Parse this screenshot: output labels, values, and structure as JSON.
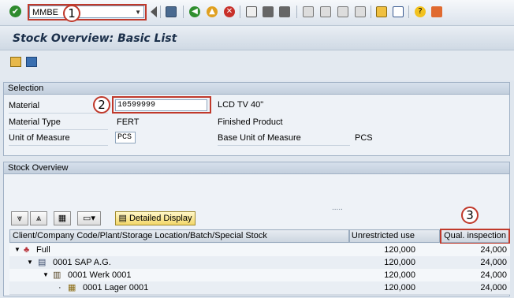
{
  "toolbar": {
    "command_value": "MMBE",
    "icons": [
      "enter-icon",
      "back-nav-icon",
      "save-icon",
      "back-icon",
      "exit-icon",
      "cancel-icon",
      "print-icon",
      "find-icon",
      "find-next-icon",
      "first-page-icon",
      "previous-page-icon",
      "next-page-icon",
      "last-page-icon",
      "create-session-icon",
      "shortcut-icon",
      "help-icon",
      "customize-layout-icon"
    ]
  },
  "callouts": [
    "1",
    "2",
    "3"
  ],
  "title": "Stock Overview: Basic List",
  "selection": {
    "heading": "Selection",
    "material_label": "Material",
    "material_value": "10599999",
    "material_desc": "LCD TV 40\"",
    "type_label": "Material Type",
    "type_value": "FERT",
    "type_desc": "Finished Product",
    "uom_label": "Unit of Measure",
    "uom_value": "PCS",
    "base_uom_label": "Base Unit of Measure",
    "base_uom_value": "PCS"
  },
  "overview": {
    "heading": "Stock Overview",
    "dots": ".....",
    "detail_button": "Detailed Display",
    "columns": {
      "hierarchy": "Client/Company Code/Plant/Storage Location/Batch/Special Stock",
      "unrestricted": "Unrestricted use",
      "qual": "Qual. inspection"
    },
    "rows": [
      {
        "label": "Full",
        "unrestricted": "120,000",
        "qual": "24,000"
      },
      {
        "label": "0001 SAP A.G.",
        "unrestricted": "120,000",
        "qual": "24,000"
      },
      {
        "label": "0001 Werk 0001",
        "unrestricted": "120,000",
        "qual": "24,000"
      },
      {
        "label": "0001 Lager 0001",
        "unrestricted": "120,000",
        "qual": "24,000"
      }
    ]
  },
  "colors": {
    "highlight": "#c0392b",
    "title": "#1b2f4a"
  }
}
